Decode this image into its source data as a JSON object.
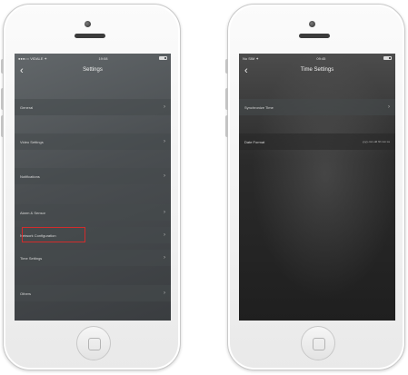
{
  "left_phone": {
    "status": {
      "carrier": "●●●○○ VIDALE ✦",
      "time": "19:08",
      "battery_icon": "battery-icon"
    },
    "nav": {
      "back_icon": "‹",
      "title": "Settings"
    },
    "items": [
      {
        "label": "General"
      },
      {
        "label": "Video Settings"
      },
      {
        "label": "Notifications"
      },
      {
        "label": "Alarm & Sensor"
      },
      {
        "label": "Network Configuration"
      },
      {
        "label": "Time Settings"
      },
      {
        "label": "Others"
      }
    ],
    "chevron": "›",
    "highlight_color": "#d22c2c"
  },
  "right_phone": {
    "status": {
      "carrier": "No SIM ✦",
      "time": "09:45",
      "battery_icon": "battery-icon"
    },
    "nav": {
      "back_icon": "‹",
      "title": "Time Settings"
    },
    "items": [
      {
        "label": "Synchronize Time",
        "value": ""
      },
      {
        "label": "Date Format",
        "value": "yyyy-mm-dd hh:mm:ss"
      }
    ],
    "chevron": "›"
  }
}
